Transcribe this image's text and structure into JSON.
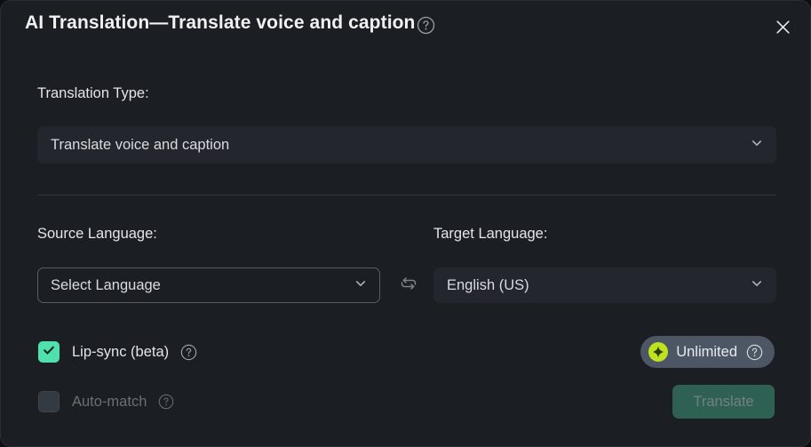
{
  "dialog": {
    "title": "AI Translation—Translate voice and caption",
    "title_help_icon": "help-circle-icon",
    "close_icon": "close-icon",
    "accent_green": "#4fe0ac",
    "pill_bg": "#4d5665",
    "star_color": "#bfe220",
    "button_bg": "#2f6054"
  },
  "translation_type": {
    "label": "Translation Type:",
    "value": "Translate voice and caption",
    "chevron_icon": "chevron-down-icon"
  },
  "source_language": {
    "label": "Source Language:",
    "value": "Select Language",
    "placeholder": "Select Language",
    "chevron_icon": "chevron-down-icon"
  },
  "swap": {
    "icon": "swap-languages-icon"
  },
  "target_language": {
    "label": "Target Language:",
    "value": "English (US)",
    "chevron_icon": "chevron-down-icon"
  },
  "lip_sync": {
    "label": "Lip-sync (beta)",
    "checked": true,
    "help_icon": "help-circle-icon"
  },
  "auto_match": {
    "label": "Auto-match",
    "checked": false,
    "disabled": true,
    "help_icon": "help-circle-icon"
  },
  "unlimited_badge": {
    "label": "Unlimited",
    "star_icon": "sparkle-star-icon",
    "help_icon": "help-circle-icon"
  },
  "translate_button": {
    "label": "Translate",
    "disabled": true
  }
}
